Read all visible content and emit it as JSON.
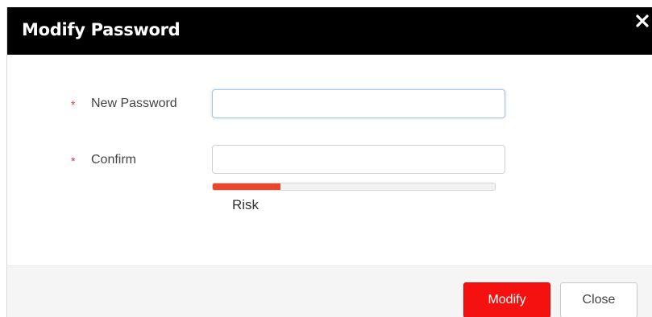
{
  "dialog": {
    "title": "Modify Password",
    "close_icon": "close-icon"
  },
  "form": {
    "new_password": {
      "required_mark": "*",
      "label": "New Password",
      "value": ""
    },
    "confirm": {
      "required_mark": "*",
      "label": "Confirm",
      "value": ""
    },
    "strength": {
      "label": "Risk",
      "level_fraction": 0.24,
      "color": "#e8472c"
    }
  },
  "footer": {
    "modify_label": "Modify",
    "close_label": "Close"
  },
  "colors": {
    "header_bg": "#000000",
    "accent": "#f5110f",
    "required": "#e53935"
  }
}
